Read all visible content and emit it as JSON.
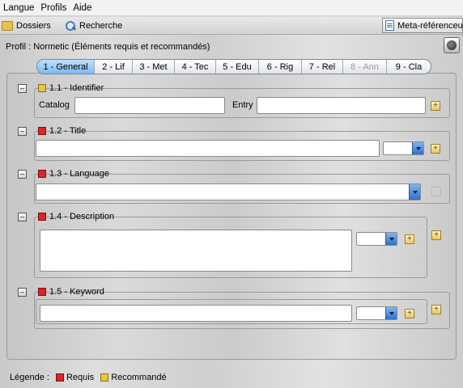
{
  "menu": [
    "Langue",
    "Profils",
    "Aide"
  ],
  "toolbar": {
    "folders_label": "Dossiers",
    "search_label": "Recherche",
    "meta_label": "Meta-référenceur"
  },
  "profile_text": "Profil : Normetic (Éléments requis et recommandés)",
  "tabs": [
    {
      "label": "1 - General",
      "state": "active"
    },
    {
      "label": "2 - Lif",
      "state": "normal"
    },
    {
      "label": "3 - Met",
      "state": "normal"
    },
    {
      "label": "4 - Tec",
      "state": "normal"
    },
    {
      "label": "5 - Edu",
      "state": "normal"
    },
    {
      "label": "6 - Rig",
      "state": "normal"
    },
    {
      "label": "7 - Rel",
      "state": "normal"
    },
    {
      "label": "8 - Ann",
      "state": "disabled"
    },
    {
      "label": "9 - Cla",
      "state": "normal"
    }
  ],
  "sections": {
    "identifier": {
      "title": "1.1 - Identifier",
      "required": false,
      "catalog_label": "Catalog",
      "catalog_value": "",
      "entry_label": "Entry",
      "entry_value": ""
    },
    "title": {
      "title": "1.2 - Title",
      "required": true,
      "value": "",
      "lang": ""
    },
    "language": {
      "title": "1.3 - Language",
      "required": true,
      "value": ""
    },
    "description": {
      "title": "1.4 - Description",
      "required": true,
      "value": "",
      "lang": ""
    },
    "keyword": {
      "title": "1.5 - Keyword",
      "required": true,
      "value": "",
      "lang": ""
    }
  },
  "footer": {
    "legend_label": "Légende :",
    "required_label": "Requis",
    "recommended_label": "Recommandé"
  },
  "colors": {
    "required": "#d8262a",
    "recommended": "#e7c640",
    "active_tab": "#7fb9ee"
  }
}
